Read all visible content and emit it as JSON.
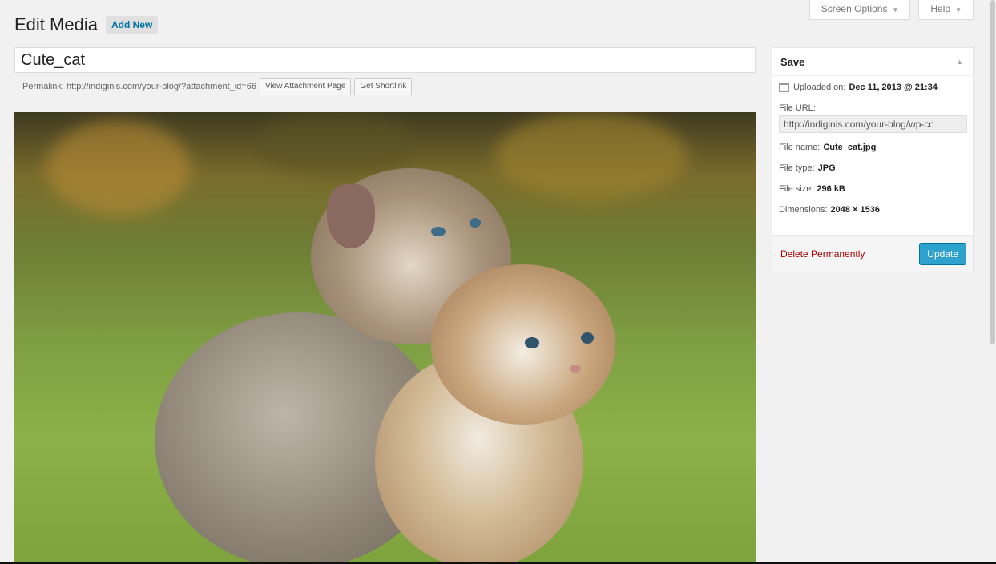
{
  "screen_meta": {
    "screen_options": "Screen Options",
    "help": "Help"
  },
  "header": {
    "title": "Edit Media",
    "add_new": "Add New"
  },
  "title_field": {
    "value": "Cute_cat"
  },
  "permalink": {
    "label": "Permalink: http://indiginis.com/your-blog/?attachment_id=66",
    "view_button": "View Attachment Page",
    "shortlink_button": "Get Shortlink"
  },
  "save_box": {
    "heading": "Save",
    "uploaded_label": "Uploaded on:",
    "uploaded_value": "Dec 11, 2013 @ 21:34",
    "file_url_label": "File URL:",
    "file_url_value": "http://indiginis.com/your-blog/wp-cc",
    "file_name_label": "File name:",
    "file_name_value": "Cute_cat.jpg",
    "file_type_label": "File type:",
    "file_type_value": "JPG",
    "file_size_label": "File size:",
    "file_size_value": "296 kB",
    "dimensions_label": "Dimensions:",
    "dimensions_value": "2048 × 1536",
    "delete_label": "Delete Permanently",
    "update_label": "Update"
  },
  "colors": {
    "accent": "#2ea2cc",
    "delete": "#aa0000",
    "link": "#0074a2"
  }
}
